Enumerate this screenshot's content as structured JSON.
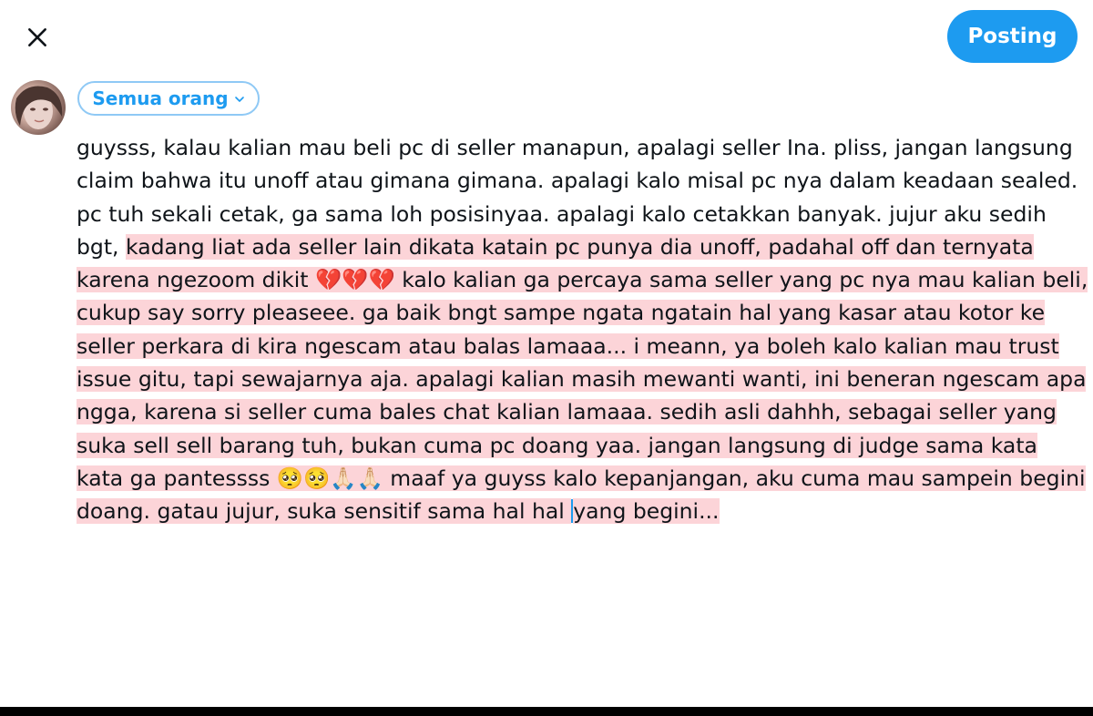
{
  "header": {
    "close_icon": "close-icon",
    "post_label": "Posting"
  },
  "composer": {
    "audience_label": "Semua orang",
    "audience_icon": "chevron-down-icon",
    "text_plain": "guysss, kalau kalian mau beli pc di seller manapun, apalagi seller Ina. pliss, jangan langsung claim bahwa itu unoff atau gimana gimana. apalagi kalo misal pc nya dalam keadaan sealed. pc tuh sekali cetak, ga sama loh posisinyaa. apalagi kalo cetakkan banyak. jujur aku sedih bgt, ",
    "text_highlight_1": "kadang liat ada seller lain dikata katain pc punya dia unoff, padahal off dan ternyata karena ngezoom dikit 💔💔💔 kalo kalian ga percaya sama seller yang pc nya mau kalian beli, cukup say sorry pleaseee. ga baik bngt sampe ngata ngatain hal yang kasar atau kotor ke seller perkara di kira ngescam atau balas lamaaa... i meann, ya boleh kalo kalian mau trust issue gitu, tapi sewajarnya aja. apalagi kalian masih mewanti wanti, ini beneran ngescam apa ngga, karena si seller cuma bales chat kalian lamaaa. sedih asli dahhh, sebagai seller yang suka sell sell barang tuh, bukan cuma pc doang yaa. jangan langsung di judge sama kata kata ga pantessss 🥺🥺🙏🏻🙏🏻 maaf ya guyss kalo kepanjangan, aku cuma mau sampein begini doang. gatau jujur, suka sensitif sama hal hal ",
    "text_highlight_2": "yang begini..."
  },
  "colors": {
    "accent": "#1d9bf0",
    "highlight": "#fcd4d8",
    "text": "#0f1419"
  }
}
